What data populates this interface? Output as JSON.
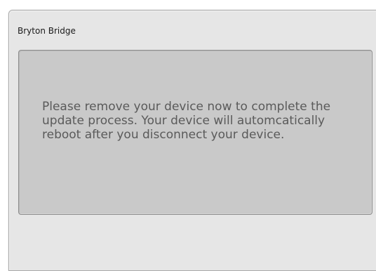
{
  "window": {
    "title": "Bryton Bridge"
  },
  "message": {
    "text": "Please remove your device now to complete the update process. Your device will automcatically reboot after you disconnect your device."
  }
}
